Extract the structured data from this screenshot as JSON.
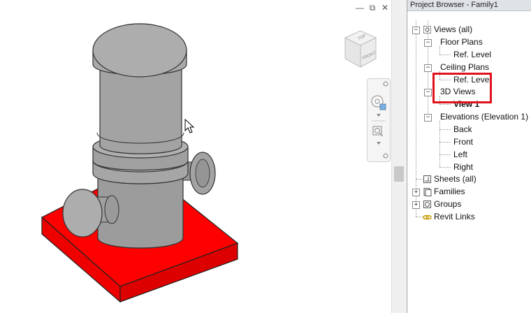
{
  "window": {
    "minimize_glyph": "—",
    "restore_glyph": "⧉",
    "close_glyph": "✕"
  },
  "viewcube": {
    "top_face": "TOP",
    "front_face": "FRONT"
  },
  "project_browser": {
    "title": "Project Browser - Family1",
    "tree": {
      "views": "Views (all)",
      "floor_plans": "Floor Plans",
      "floor_ref_level": "Ref. Level",
      "ceiling_plans": "Ceiling Plans",
      "ceiling_ref_level": "Ref. Level",
      "views_3d": "3D Views",
      "view_1": "View 1",
      "elevations": "Elevations (Elevation 1)",
      "back": "Back",
      "front": "Front",
      "left": "Left",
      "right": "Right",
      "sheets": "Sheets (all)",
      "families": "Families",
      "groups": "Groups",
      "revit_links": "Revit Links"
    }
  },
  "colors": {
    "base_plate": "#ff0000",
    "cylinder": "#a8a8a8",
    "highlight_box": "#e0131d"
  }
}
